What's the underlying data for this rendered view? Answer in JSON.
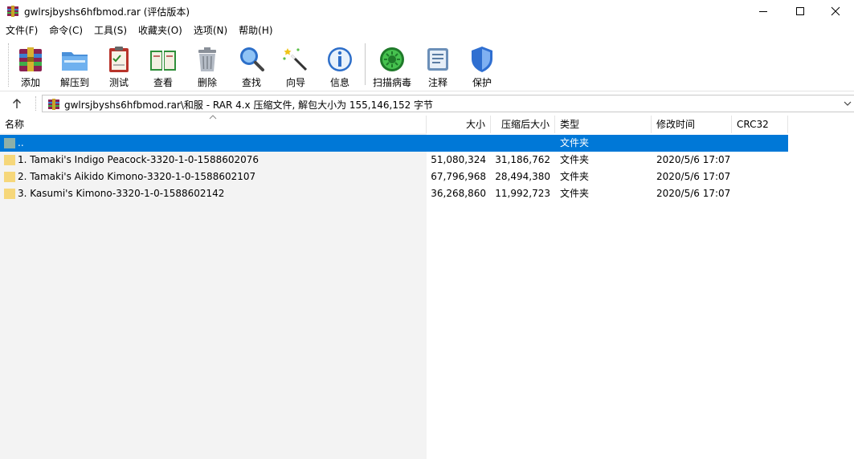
{
  "window": {
    "title": "gwlrsjbyshs6hfbmod.rar (评估版本)"
  },
  "menu": [
    {
      "label": "文件(F)"
    },
    {
      "label": "命令(C)"
    },
    {
      "label": "工具(S)"
    },
    {
      "label": "收藏夹(O)"
    },
    {
      "label": "选项(N)"
    },
    {
      "label": "帮助(H)"
    }
  ],
  "toolbar": {
    "buttons": [
      {
        "label": "添加",
        "icon": "add-archive-icon"
      },
      {
        "label": "解压到",
        "icon": "extract-folder-icon"
      },
      {
        "label": "测试",
        "icon": "test-clipboard-icon"
      },
      {
        "label": "查看",
        "icon": "view-book-icon"
      },
      {
        "label": "删除",
        "icon": "trash-icon"
      },
      {
        "label": "查找",
        "icon": "magnifier-icon"
      },
      {
        "label": "向导",
        "icon": "wizard-wand-icon"
      },
      {
        "label": "信息",
        "icon": "info-icon"
      },
      {
        "label": "扫描病毒",
        "icon": "virus-scan-icon"
      },
      {
        "label": "注释",
        "icon": "comment-icon"
      },
      {
        "label": "保护",
        "icon": "shield-icon"
      }
    ]
  },
  "address": {
    "path": "gwlrsjbyshs6hfbmod.rar\\和服 - RAR 4.x 压缩文件, 解包大小为 155,146,152 字节"
  },
  "list": {
    "columns": {
      "name": "名称",
      "size": "大小",
      "packed": "压缩后大小",
      "type": "类型",
      "modified": "修改时间",
      "crc": "CRC32"
    },
    "rows": [
      {
        "name": "..",
        "size": "",
        "packed": "",
        "type": "文件夹",
        "modified": "",
        "crc": ""
      },
      {
        "name": "1. Tamaki's Indigo Peacock-3320-1-0-1588602076",
        "size": "51,080,324",
        "packed": "31,186,762",
        "type": "文件夹",
        "modified": "2020/5/6 17:07",
        "crc": ""
      },
      {
        "name": "2. Tamaki's Aikido Kimono-3320-1-0-1588602107",
        "size": "67,796,968",
        "packed": "28,494,380",
        "type": "文件夹",
        "modified": "2020/5/6 17:07",
        "crc": ""
      },
      {
        "name": "3. Kasumi's Kimono-3320-1-0-1588602142",
        "size": "36,268,860",
        "packed": "11,992,723",
        "type": "文件夹",
        "modified": "2020/5/6 17:07",
        "crc": ""
      }
    ]
  },
  "colors": {
    "selection": "#0078d7",
    "folder": "#f6d77a"
  }
}
